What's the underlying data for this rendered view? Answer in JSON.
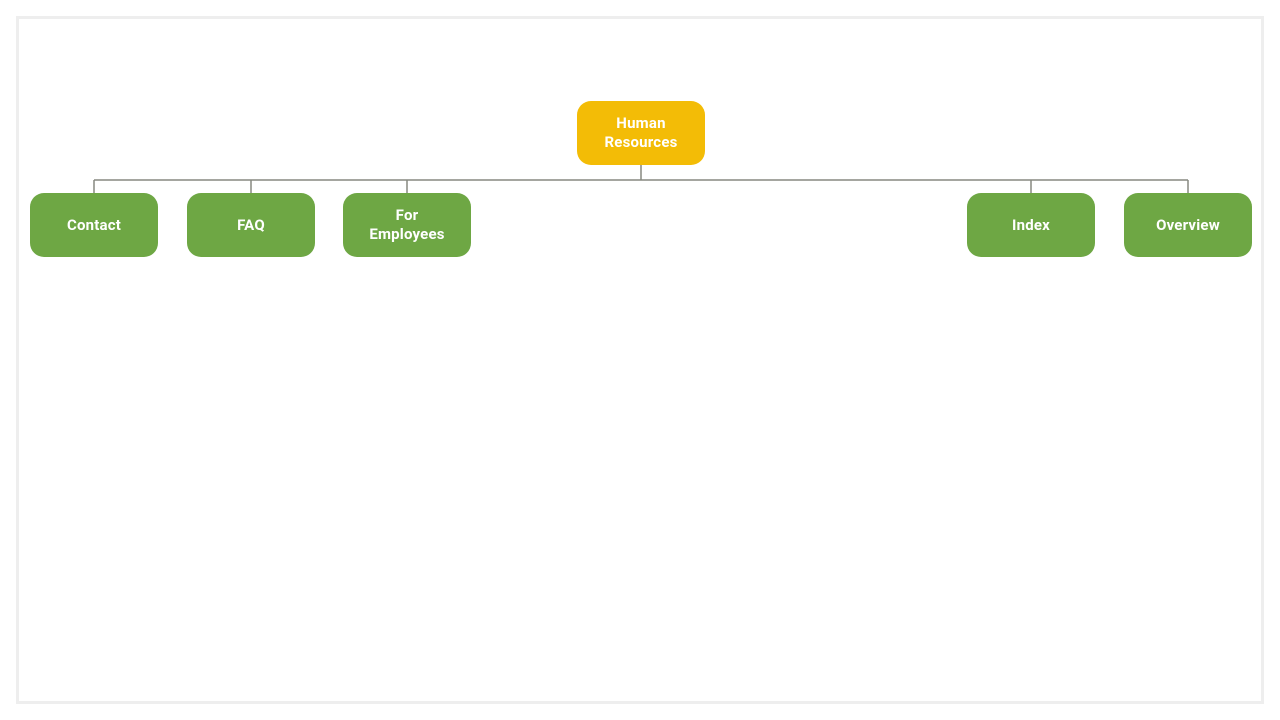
{
  "root": {
    "label": "Human Resources"
  },
  "children": [
    {
      "label": "Contact"
    },
    {
      "label": "FAQ"
    },
    {
      "label": "For Employees"
    },
    {
      "label": "Index"
    },
    {
      "label": "Overview"
    }
  ],
  "colors": {
    "root_bg": "#f3bc06",
    "child_bg": "#6ea744",
    "connector": "#878980",
    "text": "#ffffff"
  }
}
